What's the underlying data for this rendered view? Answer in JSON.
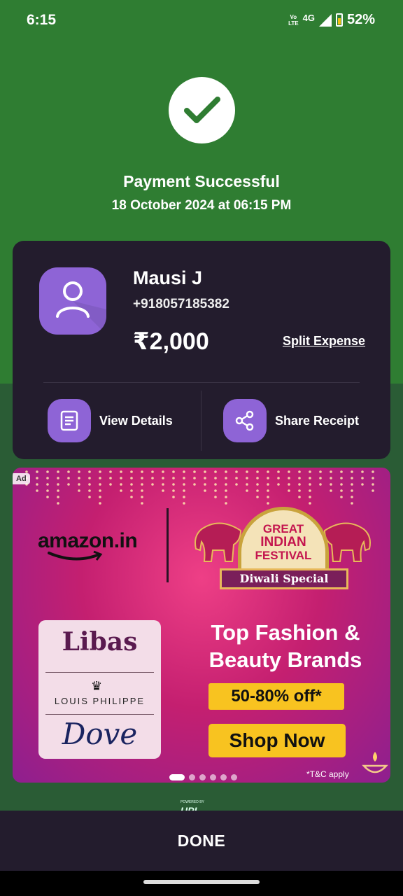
{
  "status_bar": {
    "time": "6:15",
    "volte_top": "Vo",
    "volte_bottom": "LTE",
    "network": "4G",
    "battery": "52%"
  },
  "success": {
    "title": "Payment Successful",
    "datetime": "18 October 2024 at 06:15 PM"
  },
  "payee": {
    "name": "Mausi J",
    "phone": "+918057185382",
    "amount": "₹2,000",
    "split_label": "Split Expense"
  },
  "actions": {
    "view_details": "View Details",
    "share_receipt": "Share Receipt"
  },
  "ad": {
    "badge": "Ad",
    "advertiser": "amazon.in",
    "festival": [
      "GREAT",
      "INDIAN",
      "FESTIVAL"
    ],
    "ribbon": "Diwali Special",
    "brands": {
      "brand1": "Libas",
      "brand2": "LOUIS PHILIPPE",
      "brand3": "Dove"
    },
    "headline_line1": "Top Fashion &",
    "headline_line2": "Beauty Brands",
    "discount": "50-80% off*",
    "cta": "Shop Now",
    "terms": "*T&C apply",
    "carousel_total": 6,
    "carousel_active": 1
  },
  "footer": {
    "powered": "POWERED BY",
    "done": "DONE"
  },
  "colors": {
    "header_green": "#2f7d32",
    "card_bg": "#231c2d",
    "accent_purple": "#8e64d6",
    "promo_yellow": "#f8c320"
  }
}
